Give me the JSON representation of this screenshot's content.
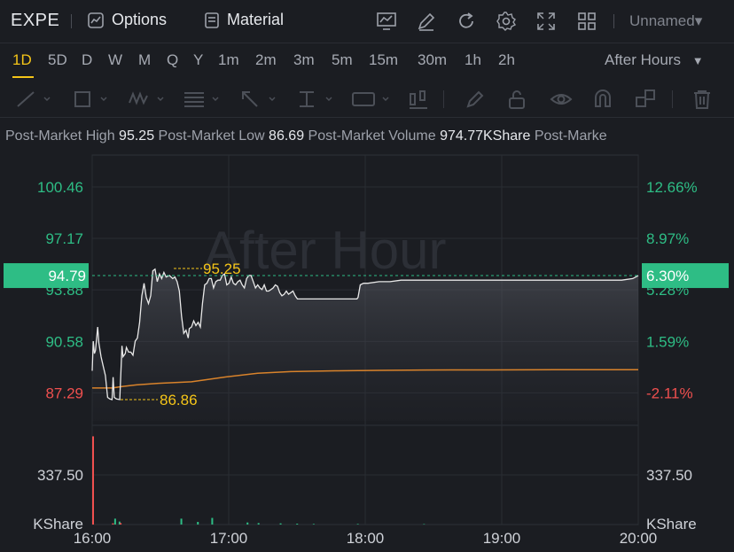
{
  "header": {
    "ticker": "EXPE",
    "options_label": "Options",
    "material_label": "Material",
    "layout_name": "Unnamed",
    "icons": [
      "indicator-icon",
      "draw-icon",
      "refresh-icon",
      "settings-icon",
      "fullscreen-icon",
      "layout-grid-icon"
    ]
  },
  "timeframes": [
    "1D",
    "5D",
    "D",
    "W",
    "M",
    "Q",
    "Y",
    "1m",
    "2m",
    "3m",
    "5m",
    "15m",
    "30m",
    "1h",
    "2h"
  ],
  "active_timeframe": "1D",
  "session_select": "After Hours",
  "stats": {
    "high_label": "Post-Market High",
    "high_value": "95.25",
    "low_label": "Post-Market Low",
    "low_value": "86.69",
    "volume_label": "Post-Market Volume",
    "volume_value": "974.77KShare",
    "extra_label": "Post-Marke"
  },
  "watermark": "After Hour",
  "colors": {
    "up": "#2ebd85",
    "down": "#f0504f",
    "accent": "#f5c518",
    "avg": "#d9832b",
    "price": "#ffffff"
  },
  "chart_data": {
    "type": "line",
    "xlim": [
      "16:00",
      "20:00"
    ],
    "ylim": [
      85.5,
      102.5
    ],
    "x_ticks": [
      "16:00",
      "17:00",
      "18:00",
      "19:00",
      "20:00"
    ],
    "y_ticks_left": [
      "100.46",
      "97.17",
      "93.88",
      "90.58",
      "87.29"
    ],
    "y_ticks_right": [
      "12.66%",
      "8.97%",
      "5.28%",
      "1.59%",
      "-2.11%"
    ],
    "y_tick_values": [
      100.46,
      97.17,
      93.88,
      90.58,
      87.29
    ],
    "current_price": "94.79",
    "current_change": "6.30%",
    "max_label": "95.25",
    "min_label": "86.86",
    "series_price": [
      [
        0,
        88.7
      ],
      [
        1,
        90.6
      ],
      [
        2,
        89.8
      ],
      [
        3,
        90.0
      ],
      [
        5,
        91.5
      ],
      [
        6,
        90.5
      ],
      [
        8,
        89.6
      ],
      [
        10,
        89.0
      ],
      [
        12,
        88.4
      ],
      [
        14,
        87.0
      ],
      [
        16,
        86.9
      ],
      [
        18,
        86.86
      ],
      [
        19,
        88.3
      ],
      [
        20,
        87.0
      ],
      [
        22,
        86.9
      ],
      [
        25,
        86.86
      ],
      [
        27,
        90.3
      ],
      [
        28,
        89.6
      ],
      [
        30,
        89.8
      ],
      [
        31,
        90.2
      ],
      [
        33,
        89.9
      ],
      [
        35,
        89.9
      ],
      [
        37,
        89.7
      ],
      [
        39,
        90.6
      ],
      [
        41,
        90.8
      ],
      [
        43,
        91.8
      ],
      [
        45,
        93.5
      ],
      [
        47,
        94.3
      ],
      [
        49,
        93.4
      ],
      [
        51,
        93.0
      ],
      [
        53,
        93.5
      ],
      [
        55,
        95.1
      ],
      [
        57,
        95.2
      ],
      [
        59,
        94.4
      ],
      [
        61,
        94.9
      ],
      [
        63,
        94.6
      ],
      [
        65,
        95.0
      ],
      [
        67,
        94.7
      ],
      [
        70,
        94.8
      ],
      [
        73,
        94.6
      ],
      [
        75,
        94.7
      ],
      [
        77,
        94.4
      ],
      [
        79,
        93.8
      ],
      [
        81,
        92.2
      ],
      [
        83,
        91.1
      ],
      [
        85,
        91.3
      ],
      [
        87,
        90.8
      ],
      [
        88,
        91.4
      ],
      [
        90,
        91.5
      ],
      [
        92,
        91.9
      ],
      [
        94,
        91.6
      ],
      [
        96,
        91.8
      ],
      [
        98,
        91.5
      ],
      [
        100,
        93.0
      ],
      [
        102,
        94.2
      ],
      [
        104,
        94.3
      ],
      [
        106,
        94.6
      ],
      [
        108,
        94.6
      ],
      [
        110,
        94.0
      ],
      [
        112,
        94.4
      ],
      [
        114,
        94.5
      ],
      [
        116,
        94.5
      ],
      [
        118,
        94.8
      ],
      [
        120,
        94.9
      ],
      [
        122,
        94.2
      ],
      [
        124,
        94.3
      ],
      [
        126,
        94.7
      ],
      [
        128,
        94.3
      ],
      [
        130,
        94.2
      ],
      [
        132,
        94.4
      ],
      [
        134,
        94.5
      ],
      [
        136,
        94.2
      ],
      [
        138,
        94.0
      ],
      [
        140,
        94.6
      ],
      [
        142,
        94.8
      ],
      [
        144,
        94.8
      ],
      [
        146,
        94.4
      ],
      [
        148,
        94.0
      ],
      [
        150,
        94.2
      ],
      [
        152,
        94.0
      ],
      [
        154,
        93.9
      ],
      [
        156,
        94.2
      ],
      [
        158,
        93.8
      ],
      [
        160,
        93.8
      ],
      [
        162,
        93.9
      ],
      [
        164,
        94.0
      ],
      [
        166,
        94.2
      ],
      [
        168,
        94.1
      ],
      [
        170,
        93.7
      ],
      [
        172,
        93.5
      ],
      [
        174,
        93.6
      ],
      [
        176,
        93.8
      ],
      [
        178,
        93.6
      ],
      [
        180,
        93.7
      ],
      [
        182,
        93.8
      ],
      [
        184,
        93.5
      ],
      [
        186,
        93.3
      ],
      [
        190,
        93.3
      ],
      [
        200,
        93.3
      ],
      [
        210,
        93.3
      ],
      [
        220,
        93.3
      ],
      [
        230,
        93.3
      ],
      [
        240,
        93.3
      ],
      [
        241,
        93.4
      ],
      [
        243,
        94.2
      ],
      [
        246,
        94.3
      ],
      [
        250,
        94.3
      ],
      [
        260,
        94.4
      ],
      [
        270,
        94.4
      ],
      [
        280,
        94.5
      ],
      [
        290,
        94.5
      ],
      [
        300,
        94.5
      ],
      [
        310,
        94.5
      ],
      [
        320,
        94.5
      ],
      [
        330,
        94.5
      ],
      [
        340,
        94.5
      ],
      [
        350,
        94.5
      ],
      [
        360,
        94.5
      ],
      [
        370,
        94.5
      ],
      [
        380,
        94.5
      ],
      [
        390,
        94.5
      ],
      [
        400,
        94.5
      ],
      [
        410,
        94.5
      ],
      [
        420,
        94.5
      ],
      [
        430,
        94.5
      ],
      [
        440,
        94.5
      ],
      [
        450,
        94.5
      ],
      [
        460,
        94.5
      ],
      [
        470,
        94.5
      ],
      [
        480,
        94.5
      ],
      [
        490,
        94.6
      ],
      [
        495,
        94.79
      ]
    ],
    "series_avg": [
      [
        0,
        87.6
      ],
      [
        18,
        87.6
      ],
      [
        27,
        87.7
      ],
      [
        40,
        87.8
      ],
      [
        60,
        87.9
      ],
      [
        90,
        88.0
      ],
      [
        120,
        88.3
      ],
      [
        150,
        88.55
      ],
      [
        180,
        88.65
      ],
      [
        220,
        88.7
      ],
      [
        260,
        88.73
      ],
      [
        300,
        88.75
      ],
      [
        360,
        88.76
      ],
      [
        420,
        88.77
      ],
      [
        495,
        88.77
      ]
    ],
    "volume_axis_label": "337.50",
    "volume_unit": "KShare",
    "volume_max": 675,
    "volume_bars": [
      [
        0,
        600,
        "down"
      ],
      [
        18,
        8,
        "down"
      ],
      [
        20,
        40,
        "up"
      ],
      [
        24,
        20,
        "up"
      ],
      [
        25,
        10,
        "down"
      ],
      [
        80,
        40,
        "up"
      ],
      [
        95,
        18,
        "up"
      ],
      [
        108,
        45,
        "up"
      ],
      [
        140,
        14,
        "up"
      ],
      [
        150,
        10,
        "up"
      ],
      [
        170,
        8,
        "up"
      ],
      [
        185,
        6,
        "up"
      ],
      [
        200,
        4,
        "up"
      ],
      [
        240,
        4,
        "up"
      ],
      [
        300,
        3,
        "up"
      ]
    ]
  }
}
